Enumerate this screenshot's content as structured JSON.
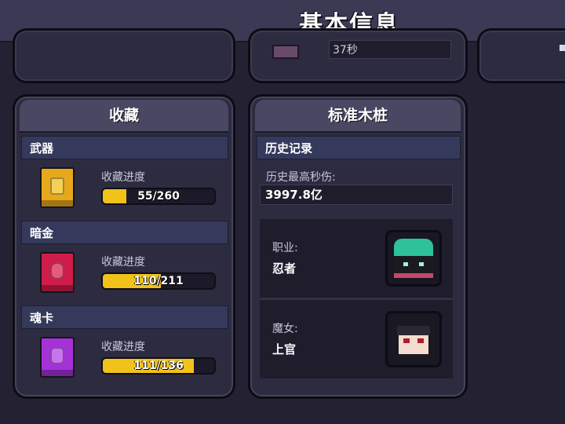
{
  "header": {
    "title": "基本信息"
  },
  "top_strip": {
    "partial_value": "37秒"
  },
  "collection": {
    "title": "收藏",
    "sections": [
      {
        "name": "武器",
        "progress_label": "收藏进度",
        "progress_text": "55/260",
        "fraction": 0.2115,
        "book_icon": "gold-book-icon"
      },
      {
        "name": "暗金",
        "progress_label": "收藏进度",
        "progress_text": "110/211",
        "fraction": 0.5213,
        "book_icon": "red-book-icon"
      },
      {
        "name": "魂卡",
        "progress_label": "收藏进度",
        "progress_text": "111/136",
        "fraction": 0.8162,
        "book_icon": "purple-book-icon"
      }
    ]
  },
  "dummy": {
    "title": "标准木桩",
    "history_title": "历史记录",
    "best_dps_label": "历史最高秒伤:",
    "best_dps_value": "3997.8亿",
    "job_label": "职业:",
    "job_value": "忍者",
    "witch_label": "魔女:",
    "witch_value": "上官"
  },
  "colors": {
    "progress_fill": "#f1c21a",
    "section_bar": "#353a5c",
    "panel": "#2d2b3f"
  }
}
